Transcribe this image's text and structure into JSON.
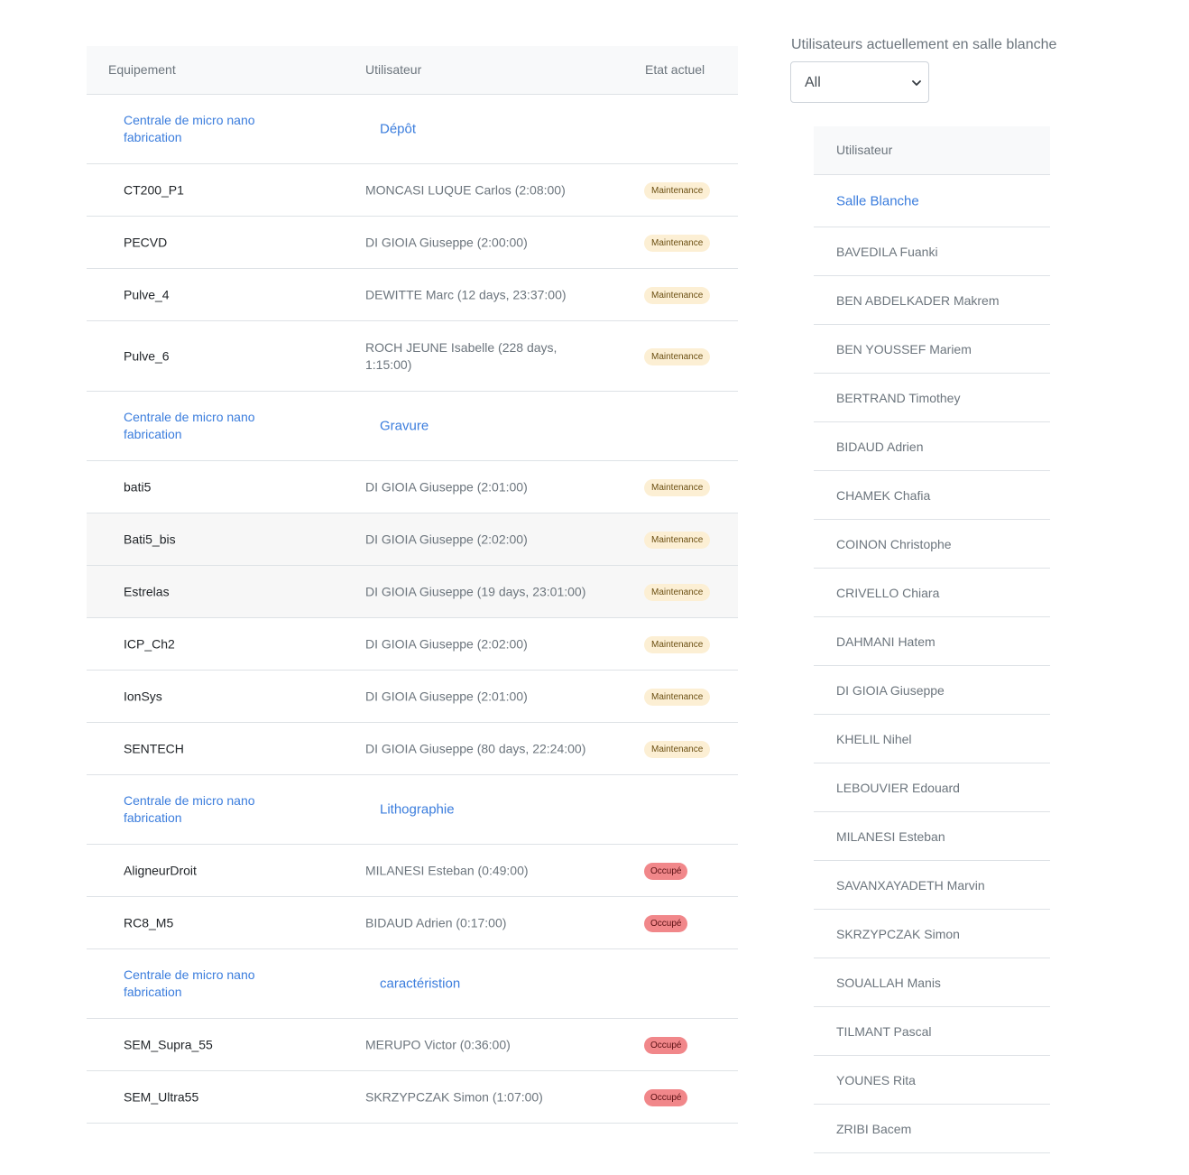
{
  "equipment_table": {
    "headers": {
      "equipment": "Equipement",
      "user": "Utilisateur",
      "state": "Etat actuel"
    },
    "rows": [
      {
        "type": "group",
        "org": "Centrale de micro nano fabrication",
        "category": "Dépôt"
      },
      {
        "type": "item",
        "equipment": "CT200_P1",
        "user": "MONCASI LUQUE Carlos (2:08:00)",
        "state": "Maintenance"
      },
      {
        "type": "item",
        "equipment": "PECVD",
        "user": "DI GIOIA Giuseppe (2:00:00)",
        "state": "Maintenance"
      },
      {
        "type": "item",
        "equipment": "Pulve_4",
        "user": "DEWITTE Marc (12 days, 23:37:00)",
        "state": "Maintenance"
      },
      {
        "type": "item",
        "equipment": "Pulve_6",
        "user": "ROCH JEUNE Isabelle (228 days, 1:15:00)",
        "state": "Maintenance",
        "tall": true
      },
      {
        "type": "group",
        "org": "Centrale de micro nano fabrication",
        "category": "Gravure"
      },
      {
        "type": "item",
        "equipment": "bati5",
        "user": "DI GIOIA Giuseppe (2:01:00)",
        "state": "Maintenance"
      },
      {
        "type": "item",
        "equipment": "Bati5_bis",
        "user": "DI GIOIA Giuseppe (2:02:00)",
        "state": "Maintenance",
        "hover": true
      },
      {
        "type": "item",
        "equipment": "Estrelas",
        "user": "DI GIOIA Giuseppe (19 days, 23:01:00)",
        "state": "Maintenance",
        "hover": true
      },
      {
        "type": "item",
        "equipment": "ICP_Ch2",
        "user": "DI GIOIA Giuseppe (2:02:00)",
        "state": "Maintenance"
      },
      {
        "type": "item",
        "equipment": "IonSys",
        "user": "DI GIOIA Giuseppe (2:01:00)",
        "state": "Maintenance"
      },
      {
        "type": "item",
        "equipment": "SENTECH",
        "user": "DI GIOIA Giuseppe (80 days, 22:24:00)",
        "state": "Maintenance"
      },
      {
        "type": "group",
        "org": "Centrale de micro nano fabrication",
        "category": "Lithographie"
      },
      {
        "type": "item",
        "equipment": "AligneurDroit",
        "user": "MILANESI Esteban (0:49:00)",
        "state": "Occupé"
      },
      {
        "type": "item",
        "equipment": "RC8_M5",
        "user": "BIDAUD Adrien (0:17:00)",
        "state": "Occupé"
      },
      {
        "type": "group",
        "org": "Centrale de micro nano fabrication",
        "category": "caractéristion"
      },
      {
        "type": "item",
        "equipment": "SEM_Supra_55",
        "user": "MERUPO Victor (0:36:00)",
        "state": "Occupé"
      },
      {
        "type": "item",
        "equipment": "SEM_Ultra55",
        "user": "SKRZYPCZAK Simon (1:07:00)",
        "state": "Occupé"
      }
    ]
  },
  "users_panel": {
    "label": "Utilisateurs actuellement en salle blanche",
    "filter": {
      "value": "All"
    },
    "header": "Utilisateur",
    "room": "Salle Blanche",
    "users": [
      "BAVEDILA Fuanki",
      "BEN ABDELKADER Makrem",
      "BEN YOUSSEF Mariem",
      "BERTRAND Timothey",
      "BIDAUD Adrien",
      "CHAMEK Chafia",
      "COINON Christophe",
      "CRIVELLO Chiara",
      "DAHMANI Hatem",
      "DI GIOIA Giuseppe",
      "KHELIL Nihel",
      "LEBOUVIER Edouard",
      "MILANESI Esteban",
      "SAVANXAYADETH Marvin",
      "SKRZYPCZAK Simon",
      "SOUALLAH Manis",
      "TILMANT Pascal",
      "YOUNES Rita",
      "ZRIBI Bacem"
    ]
  },
  "colors": {
    "link": "#3b7ddd",
    "maintenance_badge": "#fcefd4",
    "occupied_badge": "#f1878a"
  }
}
